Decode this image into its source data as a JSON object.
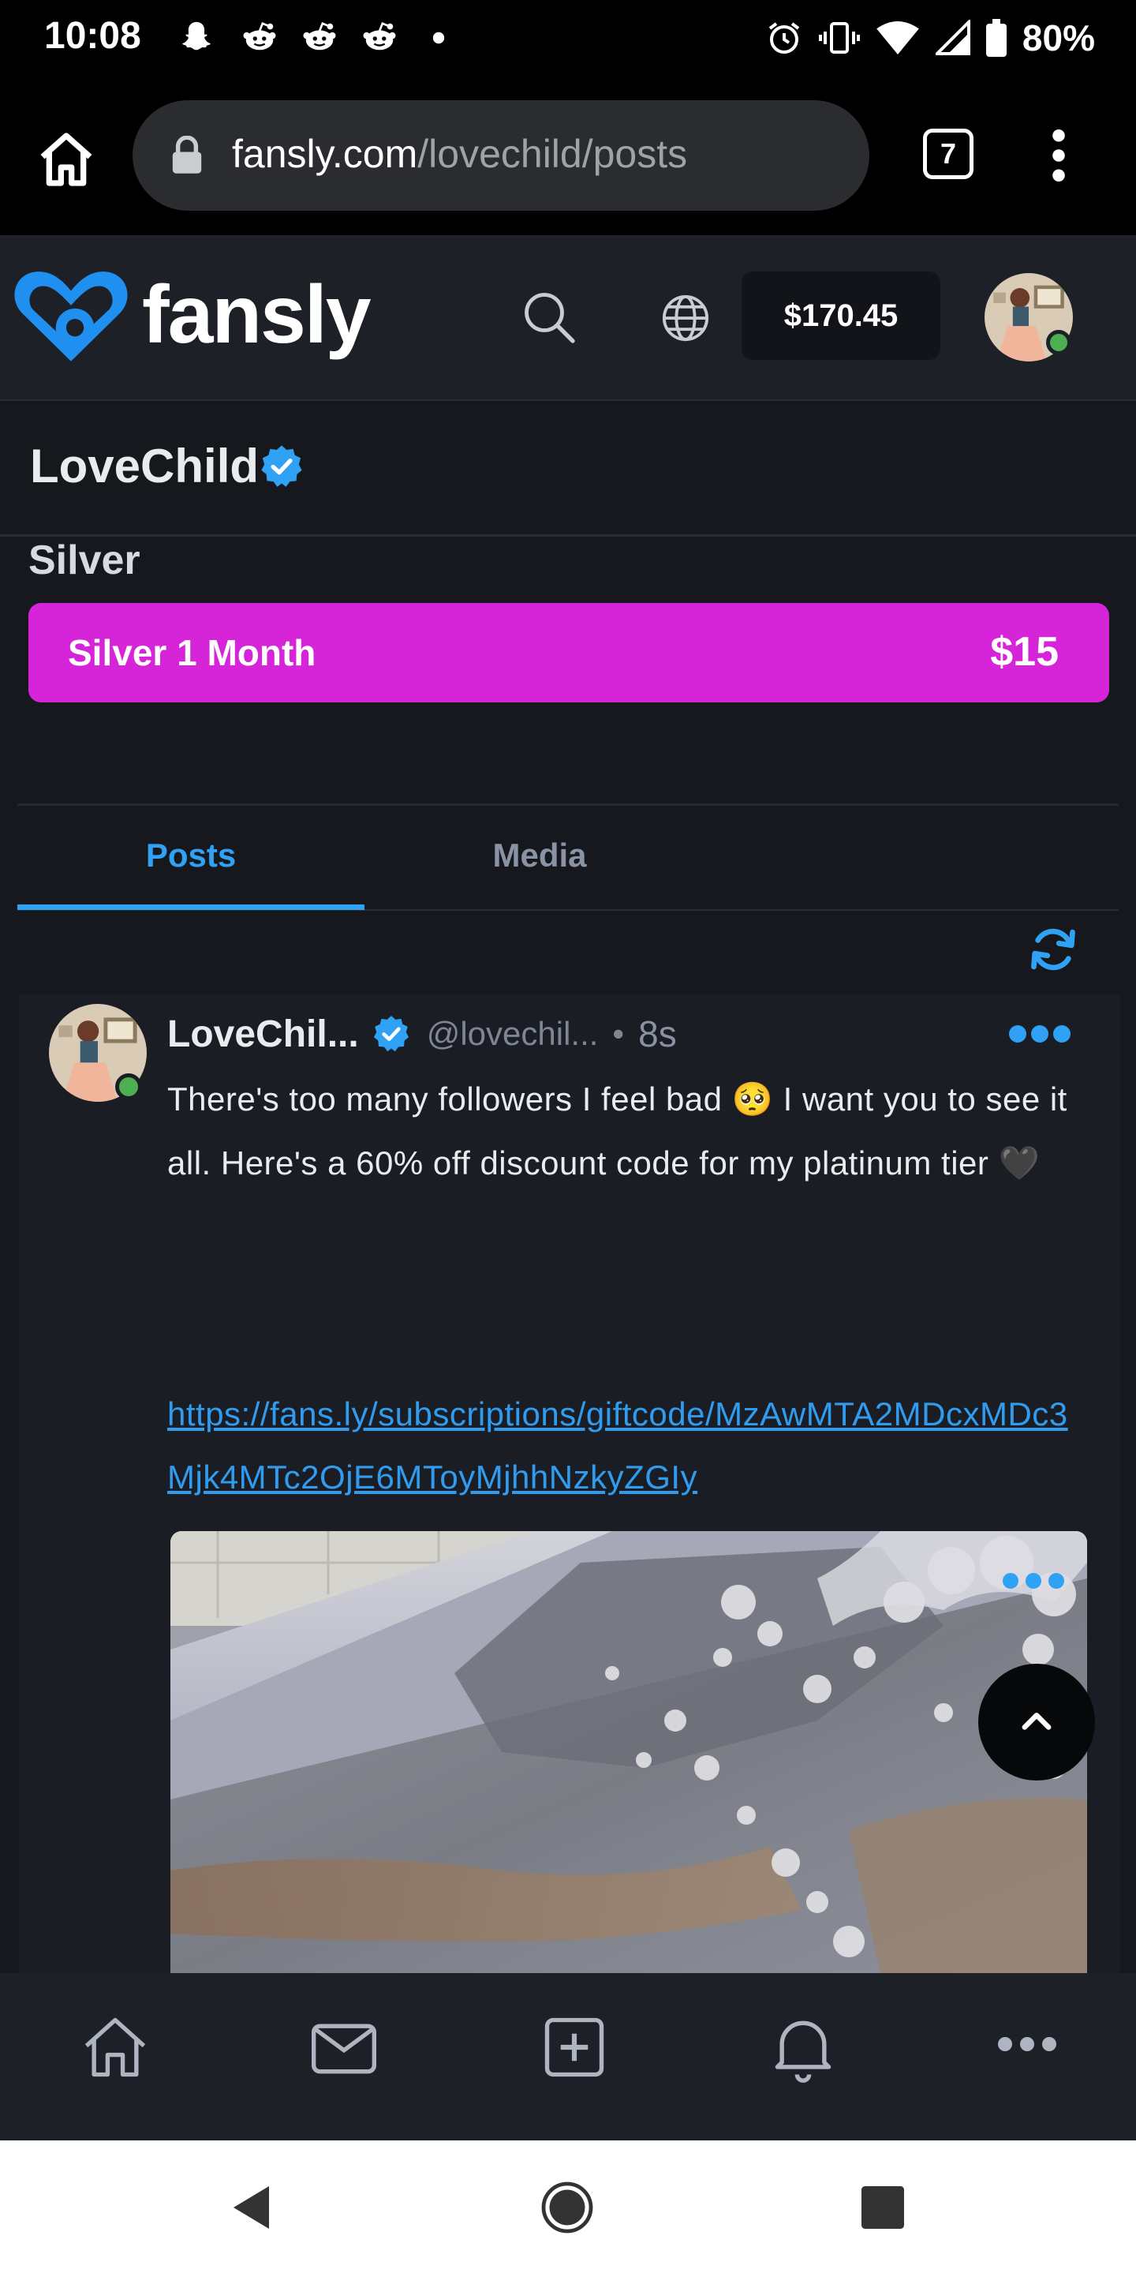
{
  "status_bar": {
    "time": "10:08",
    "battery": "80%",
    "notification_icons": [
      "snapchat-icon",
      "reddit-icon",
      "reddit-icon",
      "reddit-icon",
      "dot-icon"
    ],
    "status_icons": [
      "alarm-icon",
      "vibrate-icon",
      "wifi-icon",
      "signal-icon",
      "battery-icon"
    ]
  },
  "browser": {
    "url_host": "fansly.com",
    "url_path": "/lovechild/posts",
    "tab_count": "7"
  },
  "site_header": {
    "logo_text": "fansly",
    "balance": "$170.45"
  },
  "profile": {
    "name": "LoveChild",
    "verified": true
  },
  "tier": {
    "title": "Silver",
    "button_label": "Silver 1 Month",
    "button_price": "$15",
    "button_color": "#d624d9"
  },
  "tabs": [
    {
      "label": "Posts",
      "active": true
    },
    {
      "label": "Media",
      "active": false
    }
  ],
  "post": {
    "author": "LoveChil...",
    "handle": "@lovechil...",
    "separator": "•",
    "time": "8s",
    "text": "There's too many followers I feel bad 🥺 I want you to see it all. Here's a 60% off discount code for my platinum tier 🖤",
    "link": "https://fans.ly/subscriptions/giftcode/MzAwMTA2MDcxMDc3Mjk4MTc2OjE6MToyMjhhNzkyZGIy"
  },
  "bottom_nav": [
    "home-icon",
    "messages-icon",
    "create-post-icon",
    "notifications-icon",
    "more-icon"
  ],
  "colors": {
    "accent": "#2fa2f5",
    "background": "#16181d",
    "header": "#1d2027",
    "tier_button": "#d624d9",
    "online": "#4caf50"
  }
}
